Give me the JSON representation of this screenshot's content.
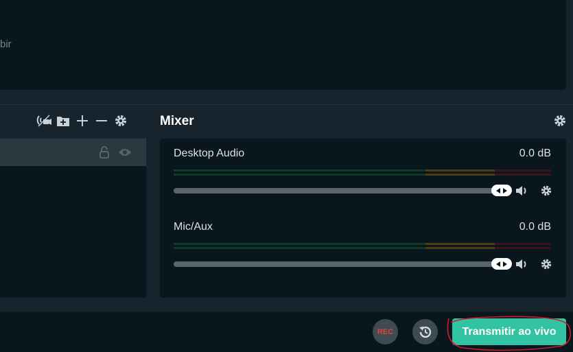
{
  "preview": {
    "text": "bir"
  },
  "scenes_toolbar": {
    "icons": [
      "studio-mode-icon",
      "add-folder-icon",
      "plus-icon",
      "minus-icon",
      "gear-icon"
    ]
  },
  "scenes": {
    "rows": [
      {
        "label": "",
        "icons": [
          "lock-icon",
          "eye-icon"
        ]
      }
    ]
  },
  "mixer": {
    "title": "Mixer",
    "channels": [
      {
        "name": "Desktop Audio",
        "db": "0.0 dB",
        "volume_percent": 100
      },
      {
        "name": "Mic/Aux",
        "db": "0.0 dB",
        "volume_percent": 100
      }
    ],
    "meter_colors": {
      "green": "#0f3a29",
      "yellow": "#4b3c12",
      "red": "#3d1418"
    }
  },
  "footer": {
    "rec_label": "REC",
    "live_label": "Transmitir ao vivo",
    "accent": "#31c3a2",
    "annotation_color": "#d4192b"
  }
}
